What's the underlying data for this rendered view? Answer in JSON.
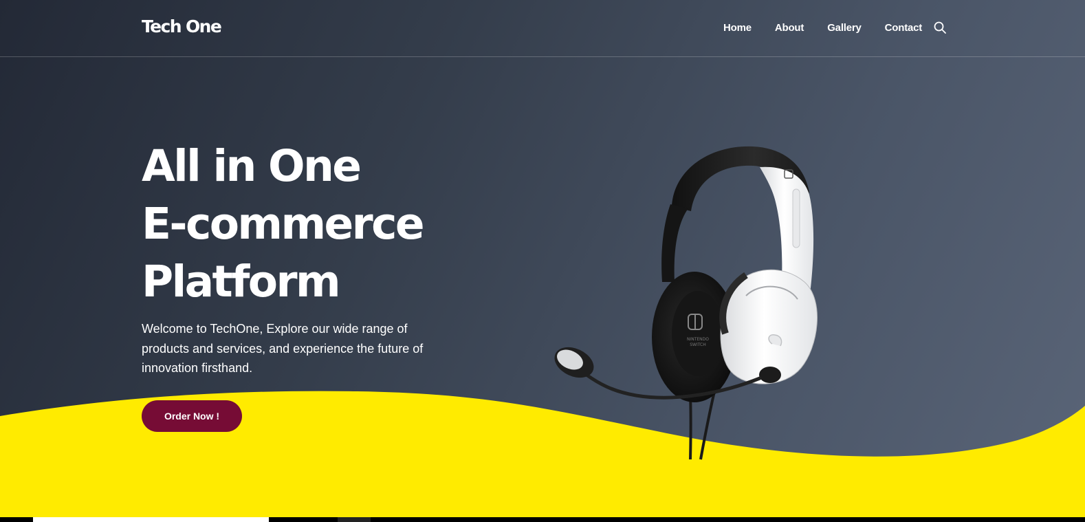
{
  "brand": {
    "logo_text": "Tech One"
  },
  "nav": {
    "items": [
      {
        "label": "Home"
      },
      {
        "label": "About"
      },
      {
        "label": "Gallery"
      },
      {
        "label": "Contact"
      }
    ],
    "search_icon": "search-icon"
  },
  "hero": {
    "title_lines": [
      "All in One",
      "E-commerce",
      "Platform"
    ],
    "description": "Welcome to TechOne, Explore our wide range of products and services, and experience the future of innovation firsthand.",
    "cta_label": "Order Now !",
    "image": "gaming-headset-image"
  },
  "colors": {
    "background_dark": "#232936",
    "background_light": "#5a6578",
    "wave_yellow": "#ffeb00",
    "button_maroon": "#760c35",
    "text": "#ffffff"
  }
}
